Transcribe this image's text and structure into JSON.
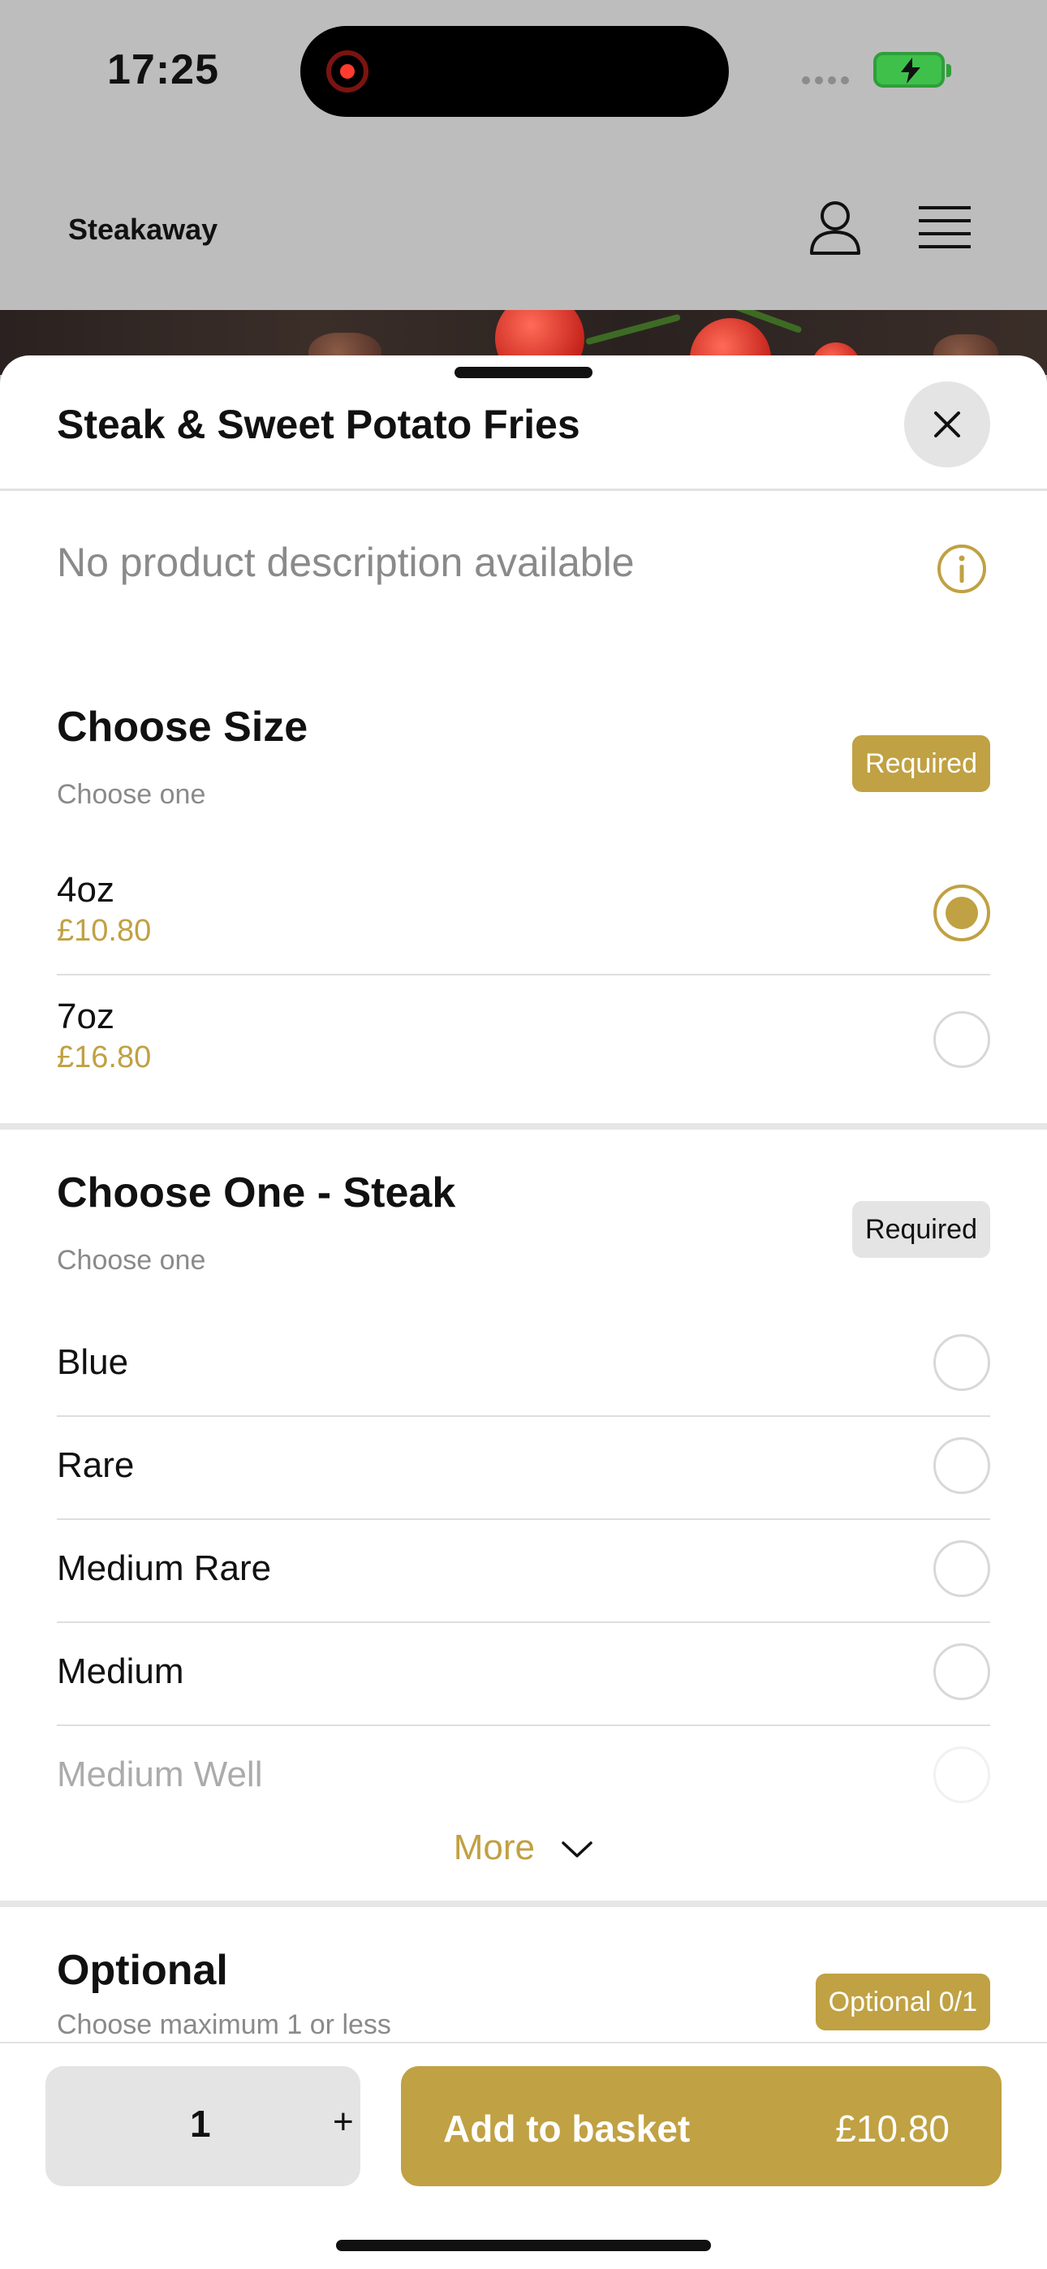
{
  "status_bar": {
    "time": "17:25"
  },
  "header": {
    "brand": "Steakaway"
  },
  "sheet": {
    "title": "Steak & Sweet Potato Fries",
    "description": "No product description available"
  },
  "groups": {
    "size": {
      "title": "Choose Size",
      "subtitle": "Choose one",
      "badge": "Required",
      "options": [
        {
          "name": "4oz",
          "price": "£10.80",
          "selected": true
        },
        {
          "name": "7oz",
          "price": "£16.80",
          "selected": false
        }
      ]
    },
    "steak": {
      "title": "Choose One - Steak",
      "subtitle": "Choose one",
      "badge": "Required",
      "options": [
        {
          "name": "Blue"
        },
        {
          "name": "Rare"
        },
        {
          "name": "Medium Rare"
        },
        {
          "name": "Medium"
        },
        {
          "name": "Medium Well"
        }
      ],
      "more_label": "More"
    },
    "optional": {
      "title": "Optional",
      "subtitle": "Choose maximum 1 or less",
      "badge": "Optional 0/1"
    }
  },
  "footer": {
    "quantity": "1",
    "plus": "+",
    "add_label": "Add to basket",
    "add_price": "£10.80"
  },
  "colors": {
    "accent": "#c0a143",
    "backdrop": "#bdbdbd"
  }
}
